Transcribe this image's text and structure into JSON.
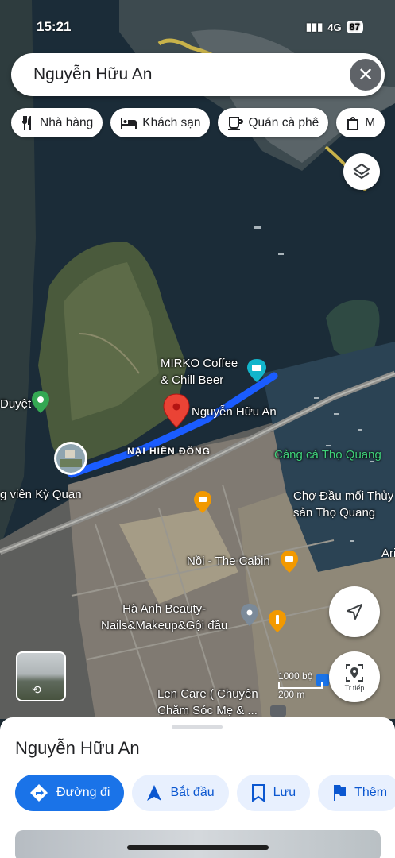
{
  "status_bar": {
    "time": "15:21",
    "network": "4G",
    "battery": "87"
  },
  "search": {
    "query": "Nguyễn Hữu An"
  },
  "chips": [
    {
      "label": "Nhà hàng",
      "icon": "restaurant-icon"
    },
    {
      "label": "Khách sạn",
      "icon": "hotel-icon"
    },
    {
      "label": "Quán cà phê",
      "icon": "coffee-icon"
    },
    {
      "label": "M",
      "icon": "shopping-bag-icon"
    }
  ],
  "map_labels": {
    "mirko": "MIRKO Coffee\n& Chill Beer",
    "street": "Nguyễn Hữu An",
    "district": "NẠI HIÊN ĐÔNG",
    "port": "Cảng cá Thọ Quang",
    "market": "Chợ Đầu mối Thủy\nsản Thọ Quang",
    "ky_quan": "g viên Kỳ Quan",
    "duyet": "Duyệt",
    "cabin": "Nồi - The Cabin",
    "beauty": "Hà Anh Beauty-\nNails&Makeup&Gội đầu",
    "len_care": "Len Care ( Chuyên\nChăm Sóc Mẹ & ...",
    "ari": "Ari",
    "scale_ft": "1000 bộ",
    "scale_m": "200 m",
    "live_label": "Tr.tiếp"
  },
  "sheet": {
    "title": "Nguyễn Hữu An",
    "actions": [
      {
        "label": "Đường đi",
        "icon": "directions-icon"
      },
      {
        "label": "Bắt đầu",
        "icon": "navigation-arrow-icon"
      },
      {
        "label": "Lưu",
        "icon": "bookmark-icon"
      },
      {
        "label": "Thêm",
        "icon": "flag-icon"
      }
    ]
  },
  "colors": {
    "route": "#1a5cff",
    "accent": "#1a73e8",
    "pin": "#ea4335",
    "poi_orange": "#f29900",
    "poi_teal": "#12b5cb",
    "poi_green": "#34a853"
  }
}
